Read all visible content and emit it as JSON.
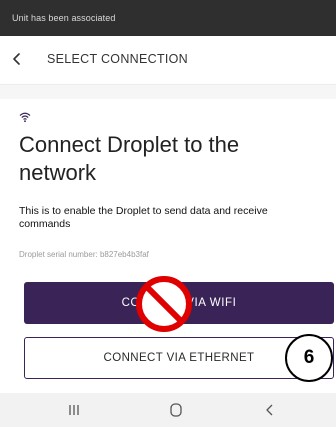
{
  "toast": {
    "message": "Unit has been associated"
  },
  "appbar": {
    "title": "SELECT CONNECTION",
    "back_icon": "chevron-left-icon"
  },
  "content": {
    "status_icon": "wifi-icon",
    "heading": "Connect Droplet to the network",
    "description": "This is to enable the Droplet to send data and receive commands",
    "serial_label": "Droplet serial number:",
    "serial_value": "b827eb4b3faf"
  },
  "buttons": {
    "wifi_label": "CONNECT VIA WIFI",
    "ethernet_label": "CONNECT VIA ETHERNET"
  },
  "overlay": {
    "prohibited_icon": "no-entry-icon",
    "step_number": "6"
  },
  "navbar": {
    "items": [
      "recent-apps-icon",
      "home-icon",
      "back-icon"
    ]
  },
  "colors": {
    "primary": "#3a2357",
    "toast_bg": "#2f2f2f",
    "prohibit_red": "#e00000"
  }
}
